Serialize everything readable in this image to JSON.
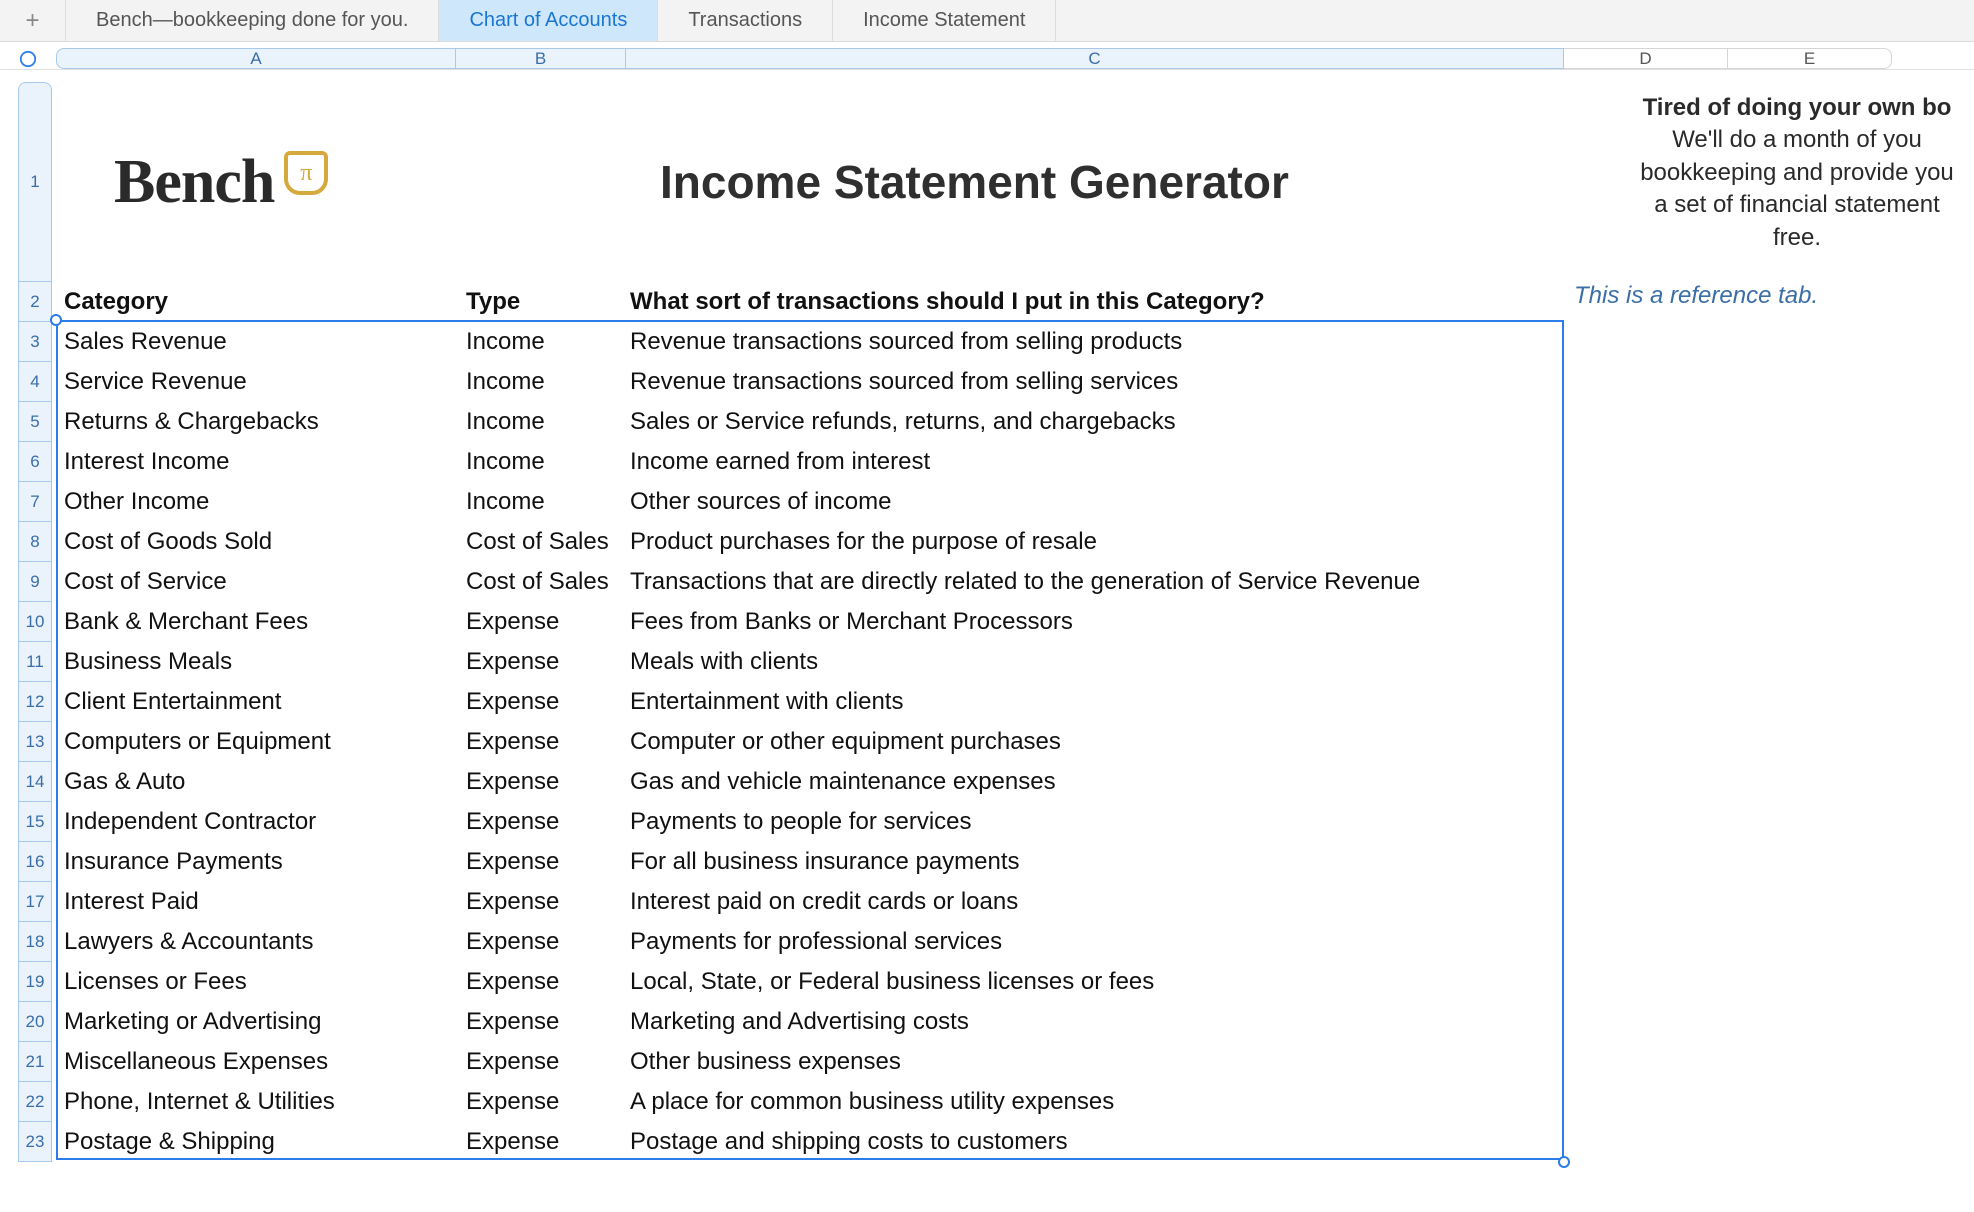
{
  "tabs": {
    "items": [
      {
        "label": "Bench—bookkeeping done for you.",
        "active": false
      },
      {
        "label": "Chart of Accounts",
        "active": true
      },
      {
        "label": "Transactions",
        "active": false
      },
      {
        "label": "Income Statement",
        "active": false
      }
    ]
  },
  "columns": [
    "A",
    "B",
    "C",
    "D",
    "E"
  ],
  "row_numbers": [
    1,
    2,
    3,
    4,
    5,
    6,
    7,
    8,
    9,
    10,
    11,
    12,
    13,
    14,
    15,
    16,
    17,
    18,
    19,
    20,
    21,
    22,
    23
  ],
  "logo": {
    "brand": "Bench",
    "badge": "π"
  },
  "title": "Income Statement Generator",
  "blurb": {
    "line1": "Tired of doing your own bo",
    "line2": "We'll do a month of you",
    "line3": "bookkeeping and provide you",
    "line4": "a set of financial statement",
    "line5": "free.",
    "ref": "This is a reference tab."
  },
  "headers": {
    "category": "Category",
    "type": "Type",
    "description": "What sort of transactions should I put in this Category?"
  },
  "rows": [
    {
      "category": "Sales Revenue",
      "type": "Income",
      "desc": "Revenue transactions sourced from selling products"
    },
    {
      "category": "Service Revenue",
      "type": "Income",
      "desc": "Revenue transactions sourced from selling services"
    },
    {
      "category": "Returns & Chargebacks",
      "type": "Income",
      "desc": "Sales or Service refunds, returns, and chargebacks"
    },
    {
      "category": "Interest Income",
      "type": "Income",
      "desc": "Income earned from interest"
    },
    {
      "category": "Other Income",
      "type": "Income",
      "desc": "Other sources of income"
    },
    {
      "category": "Cost of Goods Sold",
      "type": "Cost of Sales",
      "desc": "Product purchases for the purpose of resale"
    },
    {
      "category": "Cost of Service",
      "type": "Cost of Sales",
      "desc": "Transactions that are directly related to the generation of Service Revenue"
    },
    {
      "category": "Bank & Merchant Fees",
      "type": "Expense",
      "desc": "Fees from Banks or Merchant Processors"
    },
    {
      "category": "Business Meals",
      "type": "Expense",
      "desc": "Meals with clients"
    },
    {
      "category": "Client Entertainment",
      "type": "Expense",
      "desc": "Entertainment with clients"
    },
    {
      "category": "Computers or Equipment",
      "type": "Expense",
      "desc": "Computer or other equipment purchases"
    },
    {
      "category": "Gas & Auto",
      "type": "Expense",
      "desc": "Gas and vehicle maintenance expenses"
    },
    {
      "category": "Independent Contractor",
      "type": "Expense",
      "desc": "Payments to people for services"
    },
    {
      "category": "Insurance Payments",
      "type": "Expense",
      "desc": "For all business insurance payments"
    },
    {
      "category": "Interest Paid",
      "type": "Expense",
      "desc": "Interest paid on credit cards or loans"
    },
    {
      "category": "Lawyers & Accountants",
      "type": "Expense",
      "desc": "Payments for professional services"
    },
    {
      "category": "Licenses or Fees",
      "type": "Expense",
      "desc": "Local, State, or Federal business licenses or fees"
    },
    {
      "category": "Marketing or Advertising",
      "type": "Expense",
      "desc": "Marketing and Advertising costs"
    },
    {
      "category": "Miscellaneous Expenses",
      "type": "Expense",
      "desc": "Other business expenses"
    },
    {
      "category": "Phone, Internet & Utilities",
      "type": "Expense",
      "desc": "A place for common business utility expenses"
    },
    {
      "category": "Postage & Shipping",
      "type": "Expense",
      "desc": "Postage and shipping costs to customers"
    }
  ]
}
